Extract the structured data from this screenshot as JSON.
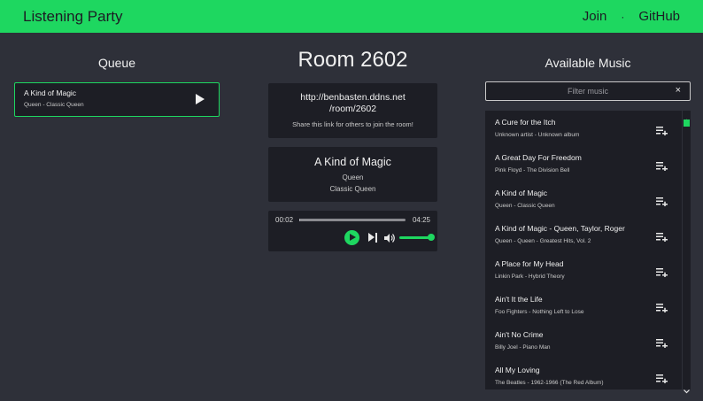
{
  "nav": {
    "brand": "Listening Party",
    "join": "Join",
    "separator": "·",
    "github": "GitHub"
  },
  "colors": {
    "accent": "#1ed760",
    "background": "#2e3039",
    "card": "#1d1e25"
  },
  "queue": {
    "title": "Queue",
    "items": [
      {
        "title": "A Kind of Magic",
        "subtitle": "Queen - Classic Queen"
      }
    ]
  },
  "room": {
    "title": "Room 2602",
    "link_line1": "http://benbasten.ddns.net",
    "link_line2": "/room/2602",
    "share_hint": "Share this link for others to join the room!"
  },
  "now_playing": {
    "title": "A Kind of Magic",
    "artist": "Queen",
    "album": "Classic Queen"
  },
  "player": {
    "current_time": "00:02",
    "total_time": "04:25",
    "progress": 0.008,
    "volume": 1.0
  },
  "music": {
    "title": "Available Music",
    "filter_placeholder": "Filter music",
    "clear_label": "×",
    "items": [
      {
        "title": "A Cure for the Itch",
        "subtitle": "Unknown artist - Unknown album"
      },
      {
        "title": "A Great Day For Freedom",
        "subtitle": "Pink Floyd - The Division Bell"
      },
      {
        "title": "A Kind of Magic",
        "subtitle": "Queen - Classic Queen"
      },
      {
        "title": "A Kind of Magic - Queen, Taylor, Roger",
        "subtitle": "Queen - Queen - Greatest Hits, Vol. 2"
      },
      {
        "title": "A Place for My Head",
        "subtitle": "Linkin Park - Hybrid Theory"
      },
      {
        "title": "Ain't It the Life",
        "subtitle": "Foo Fighters - Nothing Left to Lose"
      },
      {
        "title": "Ain't No Crime",
        "subtitle": "Billy Joel - Piano Man"
      },
      {
        "title": "All My Loving",
        "subtitle": "The Beatles - 1962-1966 (The Red Album)"
      }
    ]
  }
}
